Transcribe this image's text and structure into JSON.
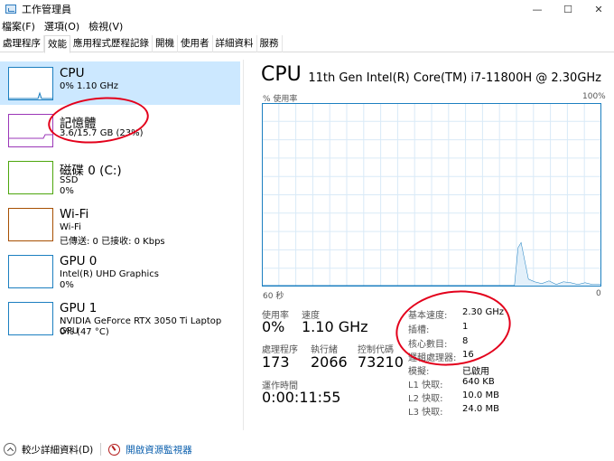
{
  "window": {
    "title": "工作管理員",
    "minimize": "—",
    "maximize": "☐",
    "close": "✕"
  },
  "menu": [
    "檔案(F)",
    "選項(O)",
    "檢視(V)"
  ],
  "tabs": [
    "處理程序",
    "效能",
    "應用程式歷程記錄",
    "開機",
    "使用者",
    "詳細資料",
    "服務"
  ],
  "resources": [
    {
      "name": "CPU",
      "sub1": "0% 1.10 GHz",
      "sub2": "",
      "color": "#1c7fc0"
    },
    {
      "name": "記憶體",
      "sub1": "3.6/15.7 GB (23%)",
      "sub2": "",
      "color": "#9b37b8"
    },
    {
      "name": "磁碟 0 (C:)",
      "sub1": "SSD",
      "sub2": "0%",
      "color": "#4da60c"
    },
    {
      "name": "Wi-Fi",
      "sub1": "Wi-Fi",
      "sub2": "已傳送: 0 已接收: 0 Kbps",
      "color": "#a74f01"
    },
    {
      "name": "GPU 0",
      "sub1": "Intel(R) UHD Graphics",
      "sub2": "0%",
      "color": "#1c7fc0"
    },
    {
      "name": "GPU 1",
      "sub1": "NVIDIA GeForce RTX 3050 Ti Laptop GPU",
      "sub2": "0% (47 °C)",
      "color": "#1c7fc0"
    }
  ],
  "detail": {
    "title": "CPU",
    "model": "11th Gen Intel(R) Core(TM) i7-11800H @ 2.30GHz",
    "axis_y_label": "% 使用率",
    "axis_y_max": "100%",
    "axis_x_left": "60 秒",
    "axis_x_right": "0",
    "usage_label": "使用率",
    "usage_value": "0%",
    "speed_label": "速度",
    "speed_value": "1.10 GHz",
    "processes_label": "處理程序",
    "processes_value": "173",
    "threads_label": "執行緒",
    "threads_value": "2066",
    "handles_label": "控制代碼",
    "handles_value": "73210",
    "uptime_label": "運作時間",
    "uptime_value": "0:00:11:55",
    "specs": [
      {
        "label": "基本速度:",
        "value": "2.30 GHz"
      },
      {
        "label": "插槽:",
        "value": "1"
      },
      {
        "label": "核心數目:",
        "value": "8"
      },
      {
        "label": "邏輯處理器:",
        "value": "16"
      },
      {
        "label": "模擬:",
        "value": "已啟用"
      },
      {
        "label": "L1 快取:",
        "value": "640 KB"
      },
      {
        "label": "L2 快取:",
        "value": "10.0 MB"
      },
      {
        "label": "L3 快取:",
        "value": "24.0 MB"
      }
    ]
  },
  "footer": {
    "fewer_details": "較少詳細資料(D)",
    "resource_monitor": "開啟資源監視器"
  },
  "colors": {
    "graph_border": "#1c7fc0",
    "graph_grid": "#d9eaf7",
    "selected_bg": "#cce8ff",
    "annotation": "#e3001b"
  }
}
